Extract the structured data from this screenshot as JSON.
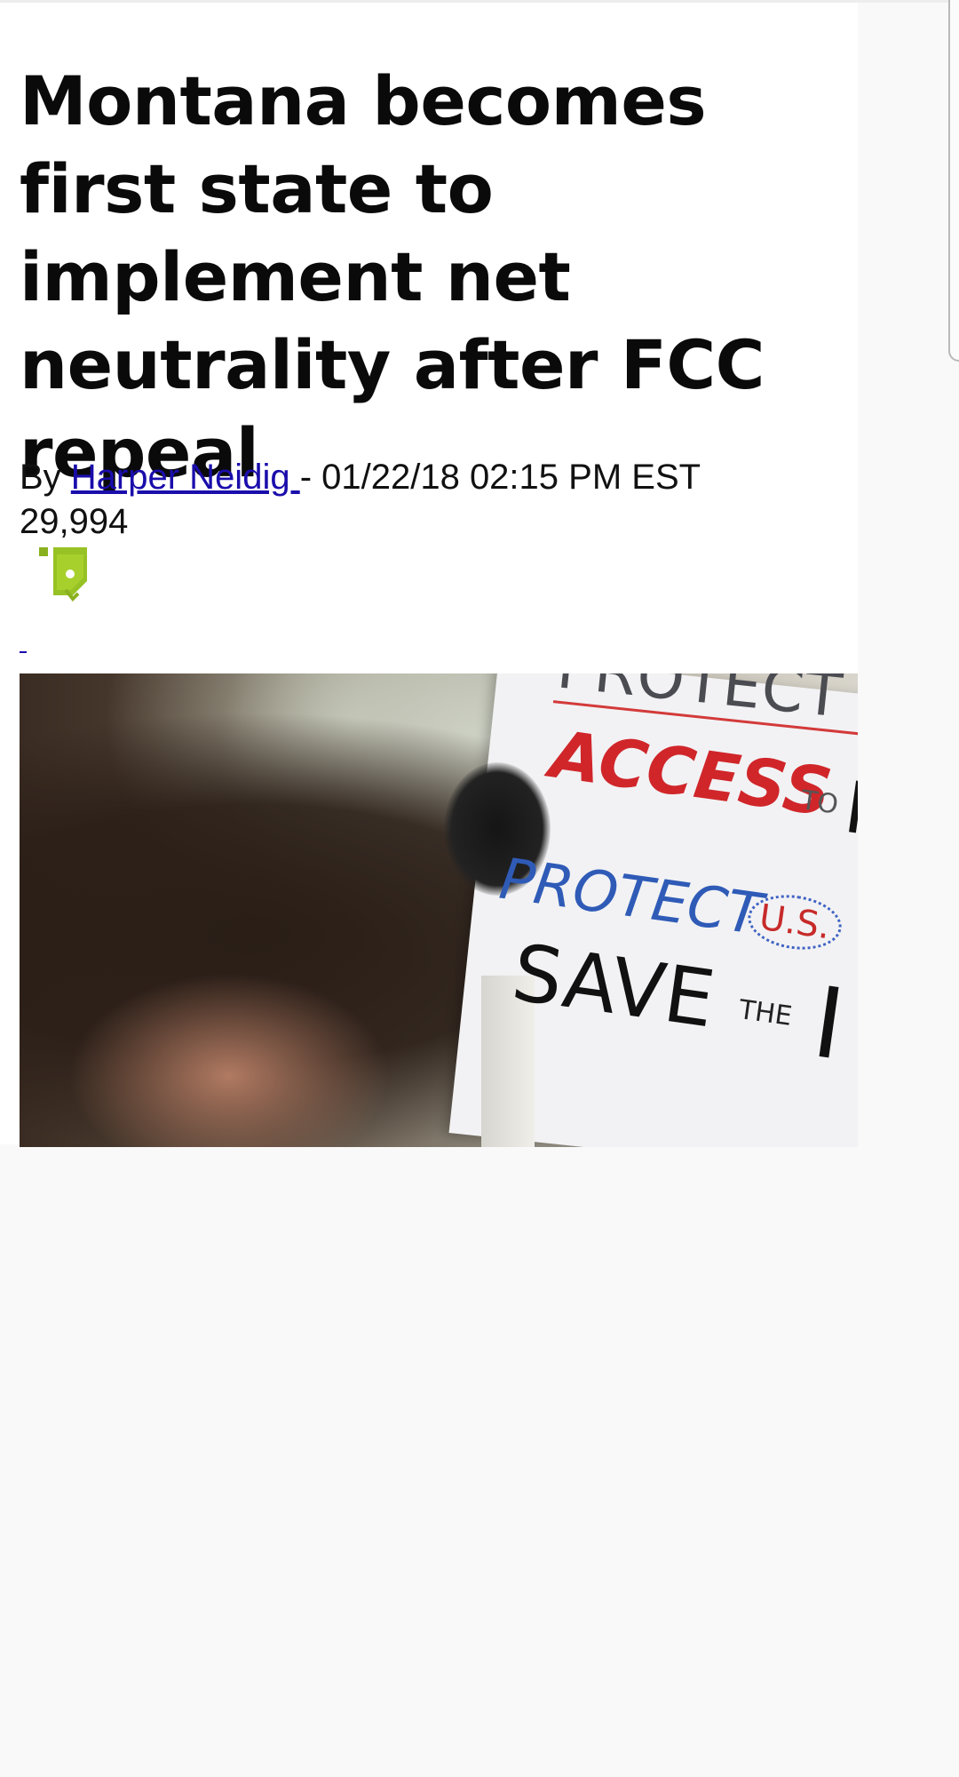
{
  "article": {
    "title": "Montana becomes first state to implement net neutrality after FCC repeal",
    "byline_prefix": "By ",
    "author": "Harper Neidig ",
    "byline_suffix": "- 01/22/18 02:15 PM EST",
    "view_count": "29,994",
    "broken_image_icon": "broken-image-icon",
    "hero_image": {
      "sign_text": {
        "line1": "PROTECT",
        "line2a": "ACCESS",
        "line2b": "TO",
        "line2c": "I",
        "line3a": "PROTECT",
        "line3b": "U.S.",
        "line4a": "SAVE",
        "line4b": "THE",
        "line4c": "I"
      }
    }
  },
  "colors": {
    "link": "#1a0dab",
    "title": "#0a0a0a",
    "page_background": "#f9f9f9",
    "article_background": "#ffffff"
  }
}
